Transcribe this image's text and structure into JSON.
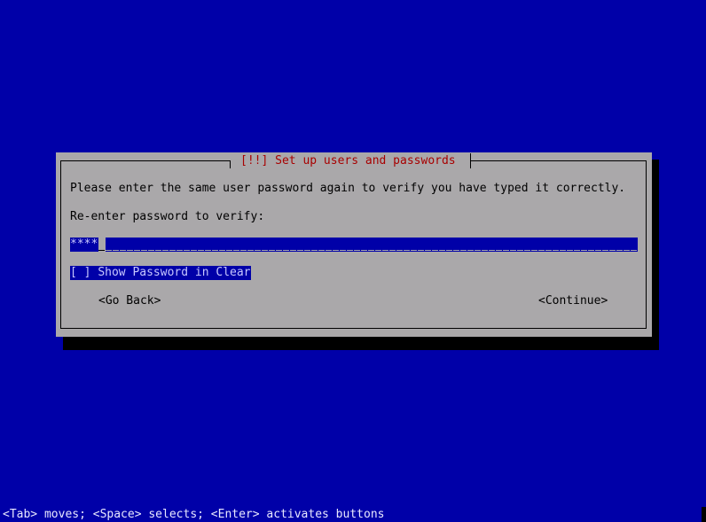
{
  "dialog": {
    "title": "[!!] Set up users and passwords",
    "prompt": "Please enter the same user password again to verify you have typed it correctly.",
    "field_label": "Re-enter password to verify:",
    "password_value": "****",
    "show_password_checkbox": {
      "state": "[ ]",
      "label": "Show Password in Clear",
      "checked": false
    },
    "buttons": {
      "back": "<Go Back>",
      "continue": "<Continue>"
    }
  },
  "statusbar": {
    "help_text": "<Tab> moves; <Space> selects; <Enter> activates buttons"
  },
  "colors": {
    "background": "#0000a8",
    "dialog": "#aaa8aa",
    "title": "#a80000",
    "highlight": "#0000a8",
    "shadow": "#000000"
  }
}
